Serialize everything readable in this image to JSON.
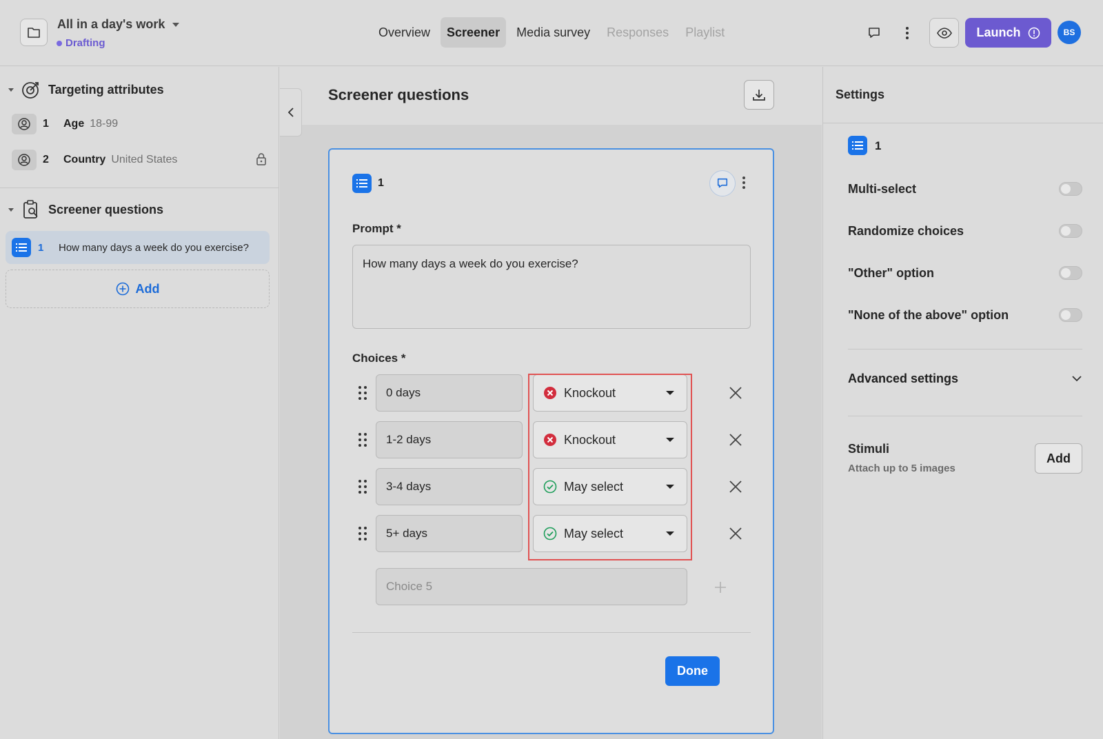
{
  "header": {
    "project_title": "All in a day's work",
    "status": "Drafting",
    "tabs": [
      {
        "label": "Overview",
        "state": "normal"
      },
      {
        "label": "Screener",
        "state": "active"
      },
      {
        "label": "Media survey",
        "state": "normal"
      },
      {
        "label": "Responses",
        "state": "disabled"
      },
      {
        "label": "Playlist",
        "state": "disabled"
      }
    ],
    "launch_label": "Launch",
    "avatar_initials": "BS"
  },
  "sidebar": {
    "targeting_title": "Targeting attributes",
    "attributes": [
      {
        "num": "1",
        "label": "Age",
        "value": "18-99"
      },
      {
        "num": "2",
        "label": "Country",
        "value": "United States"
      }
    ],
    "screener_title": "Screener questions",
    "questions": [
      {
        "num": "1",
        "text": "How many days a week do you exercise?"
      }
    ],
    "add_label": "Add"
  },
  "editor": {
    "title": "Screener questions",
    "question_num": "1",
    "prompt_label": "Prompt *",
    "prompt_value": "How many days a week do you exercise?",
    "choices_label": "Choices *",
    "choices": [
      {
        "text": "0 days",
        "rule": "Knockout",
        "rule_type": "knockout"
      },
      {
        "text": "1-2 days",
        "rule": "Knockout",
        "rule_type": "knockout"
      },
      {
        "text": "3-4 days",
        "rule": "May select",
        "rule_type": "may"
      },
      {
        "text": "5+ days",
        "rule": "May select",
        "rule_type": "may"
      }
    ],
    "new_choice_placeholder": "Choice 5",
    "done_label": "Done"
  },
  "settings": {
    "title": "Settings",
    "question_num": "1",
    "toggles": [
      {
        "label": "Multi-select",
        "on": false
      },
      {
        "label": "Randomize choices",
        "on": false
      },
      {
        "label": "\"Other\" option",
        "on": false
      },
      {
        "label": "\"None of the above\" option",
        "on": false
      }
    ],
    "advanced_label": "Advanced settings",
    "stimuli_title": "Stimuli",
    "stimuli_sub": "Attach up to 5 images",
    "stimuli_add_label": "Add"
  },
  "colors": {
    "accent": "#1a73e8",
    "launch": "#6c5ad0",
    "knockout": "#d22d3d",
    "may_select": "#1e9e5a",
    "highlight": "#e05252"
  }
}
